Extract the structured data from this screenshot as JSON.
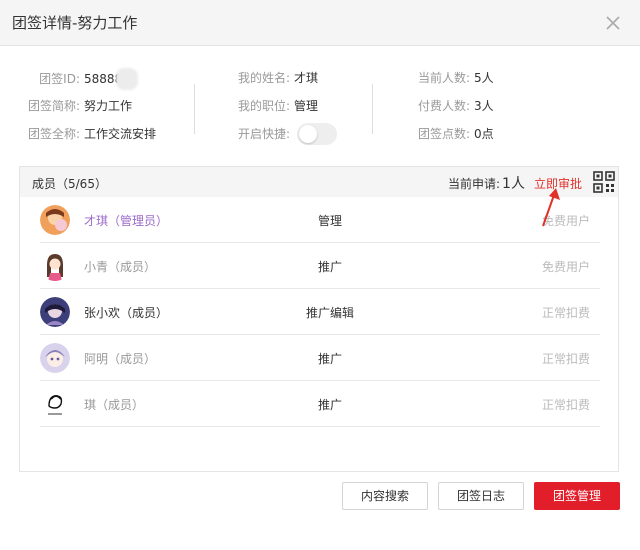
{
  "window": {
    "title": "团签详情-努力工作"
  },
  "info": {
    "col1": [
      {
        "label": "团签ID:",
        "value": "58888"
      },
      {
        "label": "团签简称:",
        "value": "努力工作"
      },
      {
        "label": "团签全称:",
        "value": "工作交流安排"
      }
    ],
    "col2": [
      {
        "label": "我的姓名:",
        "value": "才琪"
      },
      {
        "label": "我的职位:",
        "value": "管理"
      },
      {
        "label": "开启快捷:",
        "value": ""
      }
    ],
    "col3": [
      {
        "label": "当前人数:",
        "value": "5人"
      },
      {
        "label": "付费人数:",
        "value": "3人"
      },
      {
        "label": "团签点数:",
        "value": "0点"
      }
    ],
    "quick_toggle_on": false
  },
  "panel": {
    "members_label": "成员（5/65）",
    "apply_label": "当前申请:",
    "apply_count": "1人",
    "approve_label": "立即审批",
    "members": [
      {
        "name": "才琪（管理员）",
        "role": "管理",
        "status": "免费用户",
        "name_color": "#9b6bc9",
        "avatar": "avatar-orange"
      },
      {
        "name": "小青（成员）",
        "role": "推广",
        "status": "免费用户",
        "name_color": "#999999",
        "avatar": "avatar-cartoon-girl"
      },
      {
        "name": "张小欢（成员）",
        "role": "推广编辑",
        "status": "正常扣费",
        "name_color": "#333333",
        "avatar": "avatar-purple"
      },
      {
        "name": "阿明（成员）",
        "role": "推广",
        "status": "正常扣费",
        "name_color": "#999999",
        "avatar": "avatar-anime"
      },
      {
        "name": "琪（成员）",
        "role": "推广",
        "status": "正常扣费",
        "name_color": "#999999",
        "avatar": "avatar-sketch"
      }
    ]
  },
  "footer": {
    "search_label": "内容搜索",
    "log_label": "团签日志",
    "manage_label": "团签管理"
  },
  "colors": {
    "accent": "#e21e2b",
    "approve": "#e1322a"
  }
}
